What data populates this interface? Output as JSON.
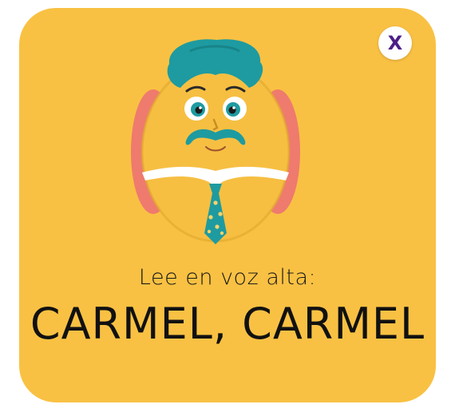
{
  "dialog": {
    "close_label": "X",
    "prompt": "Lee en voz alta:",
    "word": "CARMEL, CARMEL"
  },
  "colors": {
    "card_background": "#F9C143",
    "close_glyph": "#4B1F86",
    "hair": "#1E9BA0",
    "arms": "#EF7A6E",
    "shirt": "#FFFFFF",
    "tie": "#1E9BA0"
  },
  "icons": {
    "close": "close-icon",
    "character": "mustache-man-illustration"
  }
}
